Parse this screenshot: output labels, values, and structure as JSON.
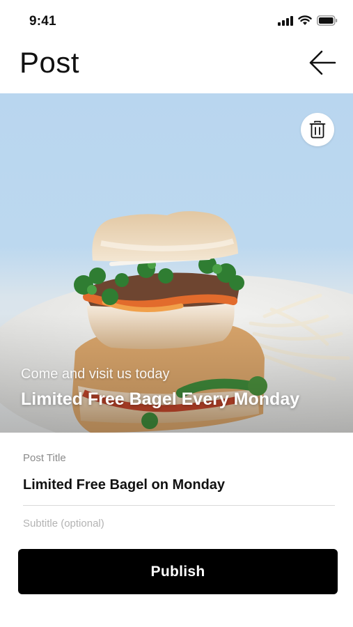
{
  "status_bar": {
    "time": "9:41"
  },
  "header": {
    "title": "Post"
  },
  "hero": {
    "overlay_subtitle": "Come and visit us today",
    "overlay_title": "Limited Free Bagel Every Monday"
  },
  "form": {
    "post_title_label": "Post Title",
    "post_title_value": "Limited Free Bagel on Monday",
    "subtitle_label": "Subtitle (optional)"
  },
  "actions": {
    "publish_label": "Publish"
  },
  "colors": {
    "primary_button": "#000000",
    "background": "#ffffff",
    "label_gray": "#8a8a8a"
  }
}
